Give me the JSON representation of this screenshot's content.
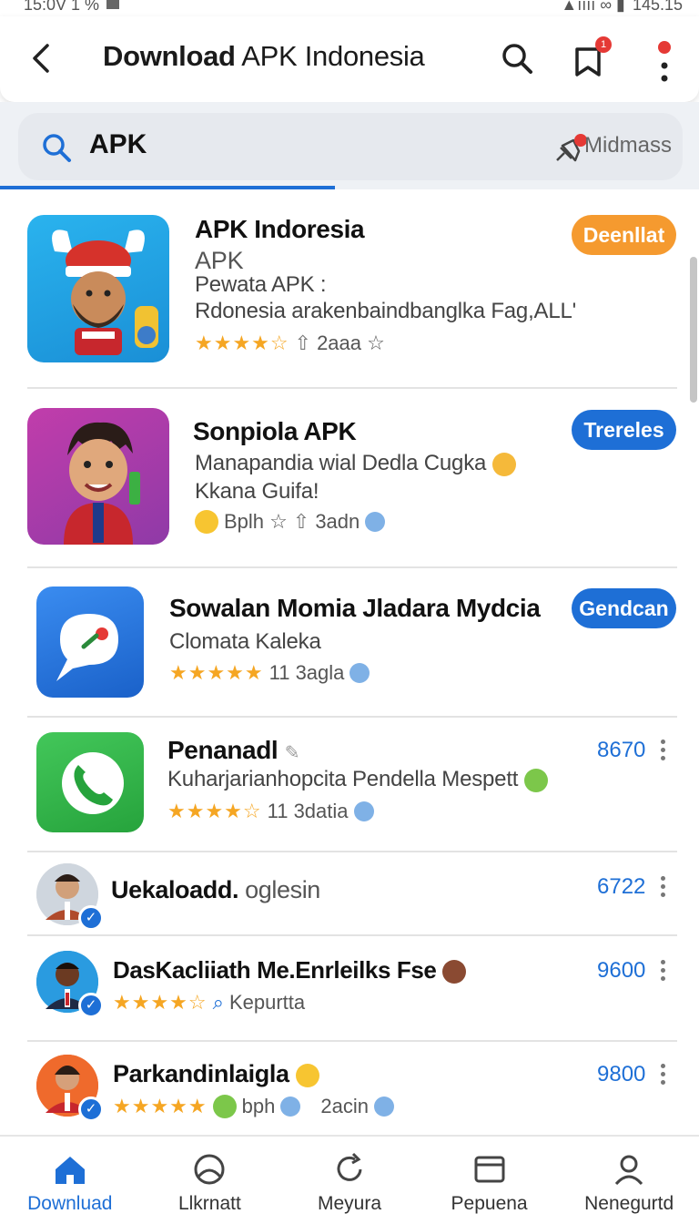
{
  "status": {
    "time": "15:0V 1 %",
    "right": "145.15"
  },
  "app_bar": {
    "title_bold": "Download",
    "title_rest": " APK Indonesia",
    "notification_count": "1"
  },
  "search": {
    "query": "APK",
    "hint": "Midmass"
  },
  "colors": {
    "accent": "#1e6fd6",
    "orange": "#f59a2f",
    "star": "#f5a623"
  },
  "apps": [
    {
      "name": "APK Indoresia",
      "line1": "APK",
      "line2": "Pewata APK  :",
      "line3": "Rdonesia arakenbaindbanglka Fag,ALL'",
      "rating": "★★★★☆",
      "meta": "2aaa ☆",
      "action": "Deenllat",
      "icon": "viking-character-icon"
    },
    {
      "name": "Sonpiola APK",
      "line1": "Manapandia wial Dedla Cugka",
      "line2": "Kkana Guifa!",
      "meta_left": "Bplh ☆",
      "meta_right": "3adn",
      "action": "Trereles",
      "icon": "boy-character-icon"
    },
    {
      "name": "Sowalan Momia Jladara Mydcia",
      "line1": "Clomata Kaleka",
      "rating": "★★★★★",
      "meta": "11  3agla",
      "action": "Gendcan",
      "icon": "chat-bubble-icon"
    },
    {
      "name": "Penanadl",
      "line1": "Kuharjarianhopcita Pendella Mespett",
      "rating": "★★★★☆",
      "meta": "11  3datia",
      "count": "8670",
      "icon": "phone-icon"
    }
  ],
  "people": [
    {
      "name": "Uekaloadd.",
      "suffix": " oglesin",
      "count": "6722"
    },
    {
      "name": "DasKacliiath Me.Enrleilks Fse",
      "rating": "★★★★☆",
      "meta": "Kepurtta",
      "count": "9600"
    },
    {
      "name": "Parkandinlaigla",
      "rating": "★★★★★",
      "meta_left": "bph",
      "meta_right": "2acin",
      "count": "9800"
    }
  ],
  "nav": [
    {
      "label": "Downluad",
      "icon": "home-icon"
    },
    {
      "label": "Llkrnatt",
      "icon": "globe-icon"
    },
    {
      "label": "Meyura",
      "icon": "refresh-icon"
    },
    {
      "label": "Pepuena",
      "icon": "window-icon"
    },
    {
      "label": "Nenegurtd",
      "icon": "person-icon"
    }
  ]
}
